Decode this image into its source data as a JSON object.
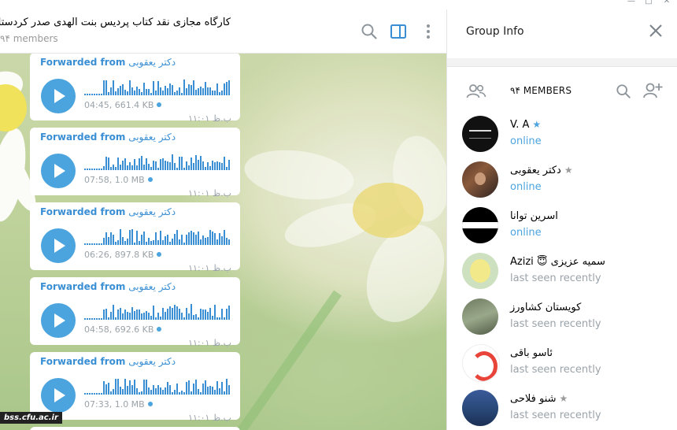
{
  "window": {
    "minimize_icon": "minimize-icon",
    "maximize_icon": "maximize-icon",
    "close_icon": "close-icon"
  },
  "chat": {
    "title": "کارگاه مجازی نقد کتاب پردیس بنت الهدی صدر کردستان",
    "members_count": "۹۴ members",
    "messages": [
      {
        "fwd_label": "Forwarded from",
        "sender": "دکتر یعقوبی",
        "meta": "04:45, 661.4 KB",
        "time": "۱۱:۰۱ ب.ظ"
      },
      {
        "fwd_label": "Forwarded from",
        "sender": "دکتر یعقوبی",
        "meta": "07:58, 1.0 MB",
        "time": "۱۱:۰۱ ب.ظ"
      },
      {
        "fwd_label": "Forwarded from",
        "sender": "دکتر یعقوبی",
        "meta": "06:26, 897.8 KB",
        "time": "۱۱:۰۱ ب.ظ"
      },
      {
        "fwd_label": "Forwarded from",
        "sender": "دکتر یعقوبی",
        "meta": "04:58, 692.6 KB",
        "time": "۱۱:۰۱ ب.ظ"
      },
      {
        "fwd_label": "Forwarded from",
        "sender": "دکتر یعقوبی",
        "meta": "07:33, 1.0 MB",
        "time": "۱۱:۰۱ ب.ظ"
      }
    ],
    "watermark": "bss.cfu.ac.ir"
  },
  "info": {
    "title": "Group Info",
    "members_label": "۹۴ MEMBERS",
    "members": [
      {
        "name": "V. A",
        "star": "★",
        "status": "online",
        "online": true
      },
      {
        "name": "دکتر یعقوبی",
        "star": "★",
        "status": "online",
        "online": true
      },
      {
        "name": "اسرین توانا",
        "star": "",
        "status": "online",
        "online": true
      },
      {
        "name": "Azizi 😇 سمیه عزیزی",
        "star": "",
        "status": "last seen recently",
        "online": false
      },
      {
        "name": "کویستان کشاورز",
        "star": "",
        "status": "last seen recently",
        "online": false
      },
      {
        "name": "ئاسو باقی",
        "star": "",
        "status": "last seen recently",
        "online": false
      },
      {
        "name": "شنو فلاحی",
        "star": "★",
        "status": "last seen recently",
        "online": false
      }
    ]
  },
  "colors": {
    "accent": "#4ca4df",
    "forward": "#3a8fd4",
    "muted": "#9aa3aa"
  }
}
